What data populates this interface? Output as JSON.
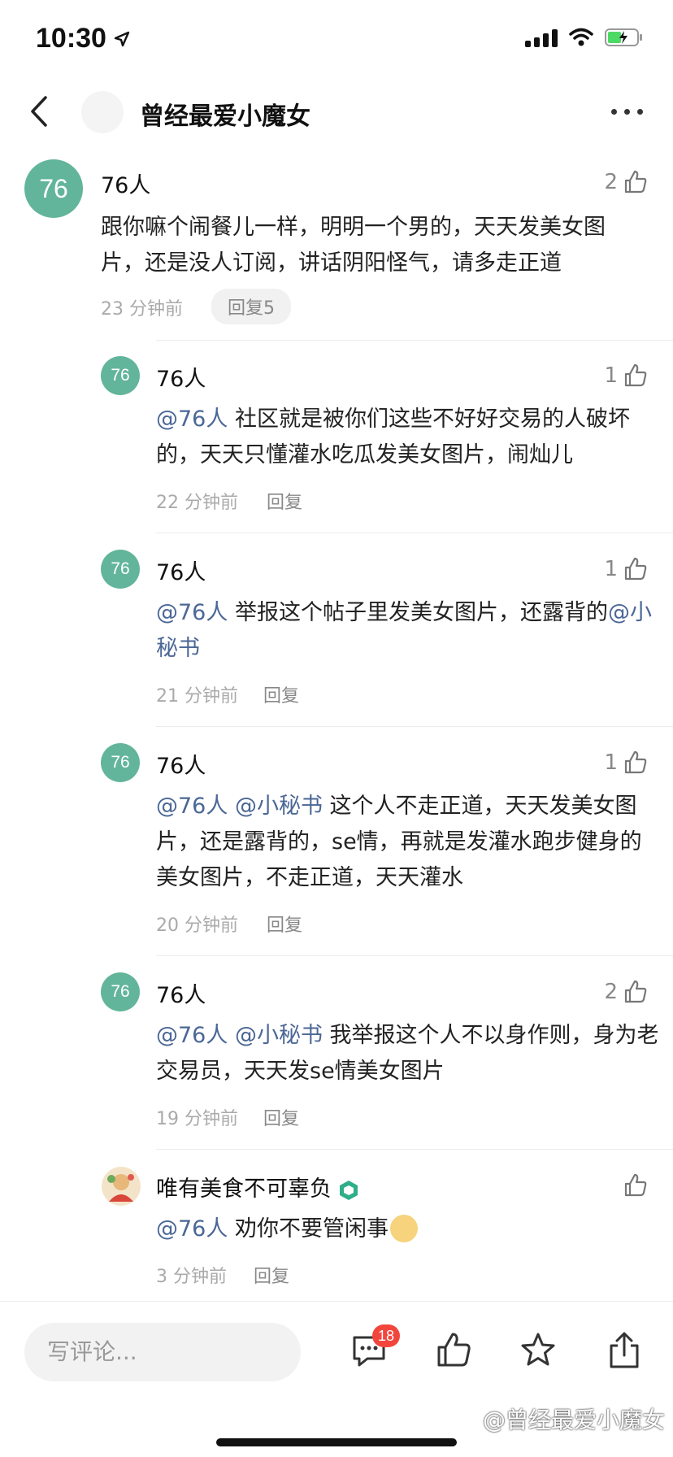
{
  "status_bar": {
    "time": "10:30",
    "icons": [
      "location-arrow-icon",
      "signal-icon",
      "wifi-icon",
      "battery-charging-icon"
    ]
  },
  "nav": {
    "title": "曾经最爱小魔女",
    "icons": [
      "back-icon",
      "more-icon"
    ]
  },
  "comments": {
    "main": {
      "avatar": "76",
      "author": "76人",
      "likes": "2",
      "text": "跟你嘛个闹餐儿一样，明明一个男的，天天发美女图片，还是没人订阅，讲话阴阳怪气，请多走正道",
      "time": "23 分钟前",
      "reply": "回复5"
    },
    "replies": [
      {
        "avatar": "76",
        "author": "76人",
        "likes": "1",
        "mention": "@76人",
        "text": " 社区就是被你们这些不好好交易的人破坏的，天天只懂灌水吃瓜发美女图片，闹灿儿",
        "time": "22 分钟前",
        "reply": "回复"
      },
      {
        "avatar": "76",
        "author": "76人",
        "likes": "1",
        "mention": "@76人",
        "text": " 举报这个帖子里发美女图片，还露背的",
        "mention2": "@小秘书",
        "time": "21 分钟前",
        "reply": "回复"
      },
      {
        "avatar": "76",
        "author": "76人",
        "likes": "1",
        "mention": "@76人 @小秘书",
        "text": " 这个人不走正道，天天发美女图片，还是露背的，se情，再就是发灌水跑步健身的美女图片，不走正道，天天灌水",
        "time": "20 分钟前",
        "reply": "回复"
      },
      {
        "avatar": "76",
        "author": "76人",
        "likes": "2",
        "mention": "@76人 @小秘书",
        "text": " 我举报这个人不以身作则，身为老交易员，天天发se情美女图片",
        "time": "19 分钟前",
        "reply": "回复"
      },
      {
        "author": "唯有美食不可辜负",
        "mention": "@76人",
        "text": " 劝你不要管闲事",
        "time": "3 分钟前",
        "reply": "回复"
      }
    ]
  },
  "bottom_bar": {
    "placeholder": "写评论...",
    "comment_count": "18",
    "watermark": "@曾经最爱小魔女"
  },
  "colors": {
    "avatar_green": "#62b59a",
    "mention_blue": "#4b6796",
    "badge_red": "#f2463d"
  }
}
